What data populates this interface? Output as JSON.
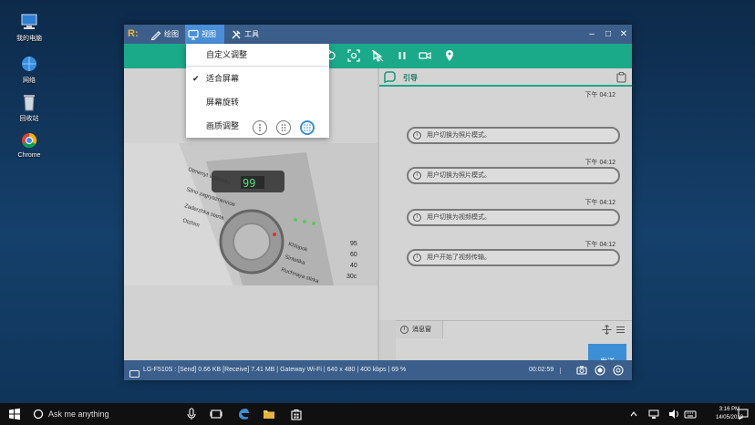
{
  "desktop": {
    "icons": [
      {
        "label": "我的电脑",
        "icon": "computer-icon"
      },
      {
        "label": "网络",
        "icon": "network-icon"
      },
      {
        "label": "回收站",
        "icon": "recycle-bin-icon"
      },
      {
        "label": "Chrome",
        "icon": "chrome-icon"
      }
    ]
  },
  "app": {
    "menu": [
      {
        "label": "绘图",
        "icon": "pencil-icon"
      },
      {
        "label": "视图",
        "icon": "monitor-icon"
      },
      {
        "label": "工具",
        "icon": "tools-icon"
      }
    ],
    "window_controls": {
      "minimize": "‒",
      "maximize": "□",
      "close": "✕"
    },
    "dropdown": {
      "items": [
        {
          "label": "自定义调整",
          "checked": false
        },
        {
          "label": "适合屏幕",
          "checked": true
        },
        {
          "label": "屏幕旋转",
          "checked": false
        },
        {
          "label": "画质调整",
          "checked": false
        }
      ],
      "check_glyph": "✔",
      "quality_options": [
        "low-quality-icon",
        "medium-quality-icon",
        "high-quality-icon"
      ],
      "selected_quality": "high-quality-icon"
    },
    "toolbar_icons": [
      "rotate-icon",
      "screenshot-icon",
      "pointer-off-icon",
      "pause-icon",
      "video-icon",
      "location-icon"
    ],
    "guide": {
      "title": "引导",
      "messages": [
        {
          "time": "下午 04:12",
          "text": "用户切换为照片模式。"
        },
        {
          "time": "下午 04:12",
          "text": "用户切换为照片模式。"
        },
        {
          "time": "下午 04:12",
          "text": "用户切换为视频模式。"
        },
        {
          "time": "下午 04:12",
          "text": "用户开始了视频传输。"
        }
      ]
    },
    "message_box": {
      "tab_label": "消息窗",
      "send_label": "发送"
    },
    "expand_glyph": "›",
    "photo": {
      "lcd_value": "99",
      "labels": [
        "Otmenyt vzgruzku",
        "Silno zagryaznennoe",
        "Zaderzhka startа",
        "Otzhim",
        "Khlopok",
        "Sintetika",
        "Ruchnaya stirka"
      ],
      "temps": [
        "95",
        "60",
        "40",
        "30c"
      ]
    },
    "status": {
      "text": "LG-F510S : [Send] 0.66 KB  [Receive] 7.41 MB | Gateway Wi-Fi | 640 x 480 | 400 kbps | 69 %",
      "timer": "00:02:59"
    },
    "colors": {
      "title_bar": "#3b5f8a",
      "toolbar": "#1aa989",
      "active_menu": "#4a8fd8",
      "send": "#3c8fd4"
    }
  },
  "taskbar": {
    "search_placeholder": "Ask me anything",
    "time": "3:16 PM",
    "date": "14/05/2018"
  }
}
